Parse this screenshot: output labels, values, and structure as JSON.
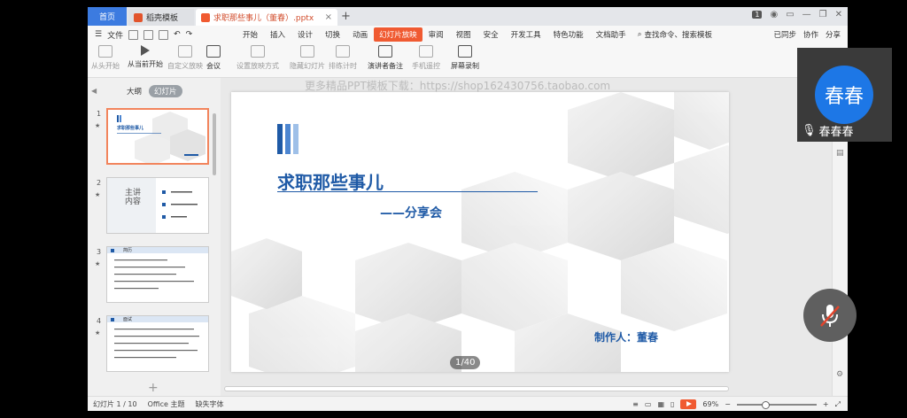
{
  "titlebar": {
    "tabs": [
      {
        "label": "首页"
      },
      {
        "label": "稻壳模板"
      },
      {
        "label": "求职那些事儿（董春）.pptx"
      }
    ],
    "badge": "1"
  },
  "menu": {
    "file": "文件",
    "items": [
      "开始",
      "插入",
      "设计",
      "切换",
      "动画",
      "幻灯片放映",
      "审阅",
      "视图",
      "安全",
      "开发工具",
      "特色功能",
      "文档助手"
    ],
    "active": "幻灯片放映",
    "search": "查找命令、搜索模板",
    "right": [
      "已同步",
      "协作",
      "分享"
    ]
  },
  "ribbon": {
    "buttons": [
      {
        "label": "从头开始",
        "enabled": false
      },
      {
        "label": "从当前开始",
        "enabled": true
      },
      {
        "label": "自定义放映",
        "enabled": false
      },
      {
        "label": "会议",
        "enabled": true
      },
      {
        "label": "设置放映方式",
        "enabled": false
      },
      {
        "label": "隐藏幻灯片",
        "enabled": false
      },
      {
        "label": "排练计时",
        "enabled": false
      },
      {
        "label": "演讲者备注",
        "enabled": true
      },
      {
        "label": "手机遥控",
        "enabled": false
      },
      {
        "label": "屏幕录制",
        "enabled": true
      }
    ]
  },
  "panel": {
    "tabs": [
      "大纲",
      "幻灯片"
    ],
    "active": "幻灯片",
    "slides": [
      {
        "num": "1",
        "title": "求职那些事儿"
      },
      {
        "num": "2",
        "title": "主讲内容"
      },
      {
        "num": "3",
        "title": "简历"
      },
      {
        "num": "4",
        "title": "面试"
      }
    ]
  },
  "slide": {
    "watermark": "更多精品PPT模板下载：https://shop162430756.taobao.com",
    "title": "求职那些事儿",
    "subtitle": "——分享会",
    "author": "制作人：董春",
    "page": "1/40",
    "bar_colors": [
      "#1f5aa6",
      "#4d86d1",
      "#9fc0e8"
    ]
  },
  "status": {
    "slide_info": "幻灯片 1 / 10",
    "theme": "Office 主题",
    "font": "缺失字体",
    "zoom": "69%"
  },
  "video": {
    "avatar": "春春",
    "name": "春春春"
  },
  "colors": {
    "accent": "#f05a31",
    "brand": "#3c7be0",
    "slide_blue": "#1f5aa6",
    "avatar": "#1d77e6"
  }
}
